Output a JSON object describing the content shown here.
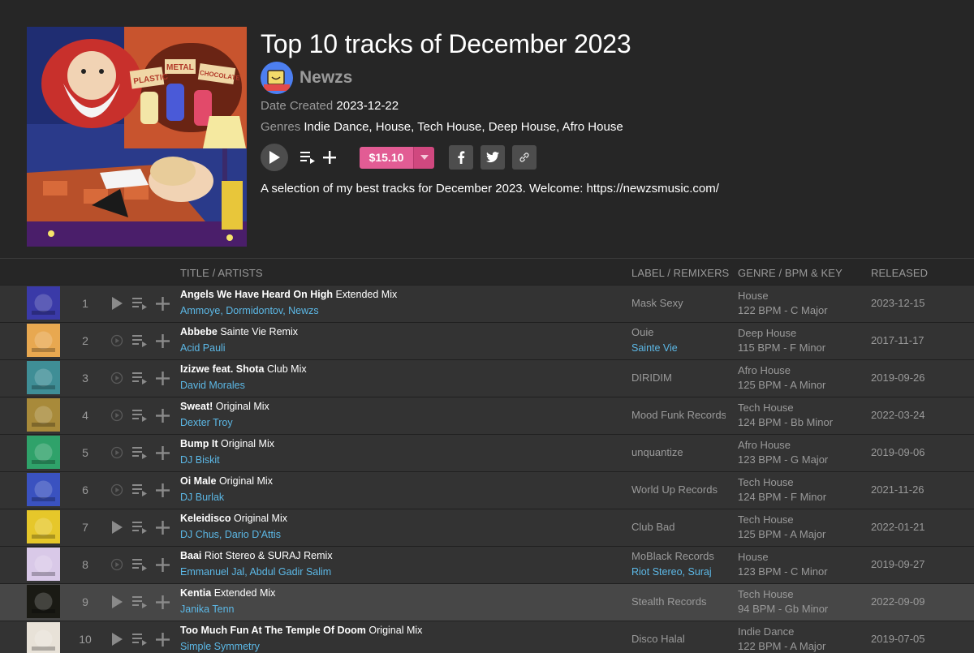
{
  "release": {
    "title": "Top 10 tracks of December 2023",
    "artist": "Newzs",
    "date_label": "Date Created",
    "date_value": "2023-12-22",
    "genres_label": "Genres",
    "genres_value": "Indie Dance, House, Tech House, Deep House, Afro House",
    "price": "$15.10",
    "description": "A selection of my best tracks for December 2023. Welcome: https://newzsmusic.com/",
    "cover_signs": [
      "PLASTIC",
      "METAL",
      "CHOCOLATE"
    ]
  },
  "table": {
    "headers": {
      "title": "TITLE / ARTISTS",
      "label": "LABEL / REMIXERS",
      "genre": "GENRE / BPM & KEY",
      "released": "RELEASED"
    },
    "rows": [
      {
        "num": "1",
        "title": "Angels We Have Heard On High",
        "mix": "Extended Mix",
        "artists": "Ammoye, Dormidontov, Newzs",
        "label": "Mask Sexy",
        "remixers": "",
        "genre": "House",
        "bpm_key": "122 BPM - C Major",
        "released": "2023-12-15",
        "playable": true,
        "thumb_color": "#3a3aa8"
      },
      {
        "num": "2",
        "title": "Abbebe",
        "mix": "Sainte Vie Remix",
        "artists": "Acid Pauli",
        "label": "Ouie",
        "remixers": "Sainte Vie",
        "genre": "Deep House",
        "bpm_key": "115 BPM - F Minor",
        "released": "2017-11-17",
        "playable": false,
        "thumb_color": "#e8a850"
      },
      {
        "num": "3",
        "title": "Izizwe feat. Shota",
        "mix": "Club Mix",
        "artists": "David Morales",
        "label": "DIRIDIM",
        "remixers": "",
        "genre": "Afro House",
        "bpm_key": "125 BPM - A Minor",
        "released": "2019-09-26",
        "playable": false,
        "thumb_color": "#3f8e96"
      },
      {
        "num": "4",
        "title": "Sweat!",
        "mix": "Original Mix",
        "artists": "Dexter Troy",
        "label": "Mood Funk Records",
        "remixers": "",
        "genre": "Tech House",
        "bpm_key": "124 BPM - Bb Minor",
        "released": "2022-03-24",
        "playable": false,
        "thumb_color": "#a88a3a"
      },
      {
        "num": "5",
        "title": "Bump It",
        "mix": "Original Mix",
        "artists": "DJ Biskit",
        "label": "unquantize",
        "remixers": "",
        "genre": "Afro House",
        "bpm_key": "123 BPM - G Major",
        "released": "2019-09-06",
        "playable": false,
        "thumb_color": "#2fa26a"
      },
      {
        "num": "6",
        "title": "Oi Male",
        "mix": "Original Mix",
        "artists": "DJ Burlak",
        "label": "World Up Records",
        "remixers": "",
        "genre": "Tech House",
        "bpm_key": "124 BPM - F Minor",
        "released": "2021-11-26",
        "playable": false,
        "thumb_color": "#3a52c0"
      },
      {
        "num": "7",
        "title": "Keleidisco",
        "mix": "Original Mix",
        "artists": "DJ Chus, Dario D'Attis",
        "label": "Club Bad",
        "remixers": "",
        "genre": "Tech House",
        "bpm_key": "125 BPM - A Major",
        "released": "2022-01-21",
        "playable": true,
        "thumb_color": "#e6c72a"
      },
      {
        "num": "8",
        "title": "Baai",
        "mix": "Riot Stereo & SURAJ Remix",
        "artists": "Emmanuel Jal, Abdul Gadir Salim",
        "label": "MoBlack Records",
        "remixers": "Riot Stereo, Suraj",
        "genre": "House",
        "bpm_key": "123 BPM - C Minor",
        "released": "2019-09-27",
        "playable": false,
        "thumb_color": "#d9c9e8"
      },
      {
        "num": "9",
        "title": "Kentia",
        "mix": "Extended Mix",
        "artists": "Janika Tenn",
        "label": "Stealth Records",
        "remixers": "",
        "genre": "Tech House",
        "bpm_key": "94 BPM - Gb Minor",
        "released": "2022-09-09",
        "playable": true,
        "thumb_color": "#1a1a14"
      },
      {
        "num": "10",
        "title": "Too Much Fun At The Temple Of Doom",
        "mix": "Original Mix",
        "artists": "Simple Symmetry",
        "label": "Disco Halal",
        "remixers": "",
        "genre": "Indie Dance",
        "bpm_key": "122 BPM - A Major",
        "released": "2019-07-05",
        "playable": true,
        "thumb_color": "#e8e2d8"
      }
    ]
  },
  "icons": {
    "play": "play-icon",
    "queue": "add-to-queue-icon",
    "add": "plus-icon",
    "facebook": "facebook-icon",
    "twitter": "twitter-icon",
    "link": "link-icon",
    "caret": "chevron-down-icon"
  },
  "colors": {
    "background": "#262626",
    "row": "#333333",
    "row_highlight": "#474747",
    "price": "#e25c94",
    "link": "#5cb8e6",
    "muted": "#9a9a9a"
  }
}
